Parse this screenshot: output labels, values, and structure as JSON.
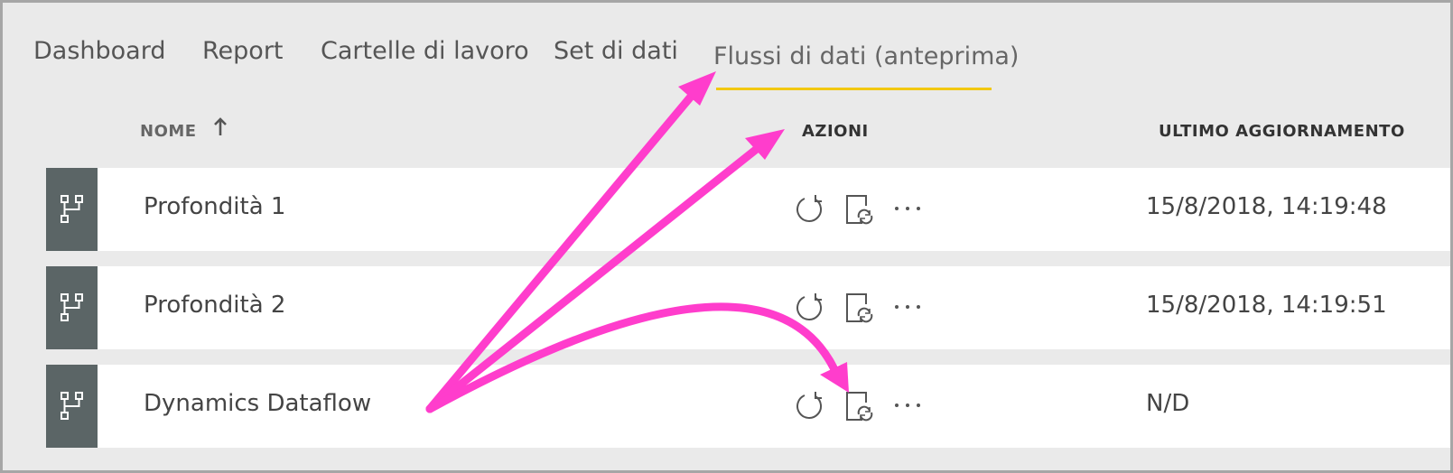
{
  "tabs": [
    {
      "label": "Dashboard"
    },
    {
      "label": "Report"
    },
    {
      "label": "Cartelle di lavoro"
    },
    {
      "label": "Set di dati"
    },
    {
      "label": "Flussi di dati (anteprima)",
      "active": true
    }
  ],
  "table": {
    "headers": {
      "name": "NOME",
      "actions": "AZIONI",
      "updated": "ULTIMO AGGIORNAMENTO"
    },
    "rows": [
      {
        "name": "Profondità 1",
        "updated": "15/8/2018, 14:19:48"
      },
      {
        "name": "Profondità 2",
        "updated": "15/8/2018, 14:19:51"
      },
      {
        "name": "Dynamics Dataflow",
        "updated": "N/D"
      }
    ]
  },
  "icons": {
    "row_type": "dataflow-icon",
    "sort": "arrow-up-icon",
    "actions": [
      "refresh-icon",
      "schedule-refresh-icon",
      "more-options-icon"
    ]
  },
  "colors": {
    "accent_underline": "#f2c811",
    "icon_box": "#5b6566",
    "annotation_arrow": "#ff3dcc"
  }
}
